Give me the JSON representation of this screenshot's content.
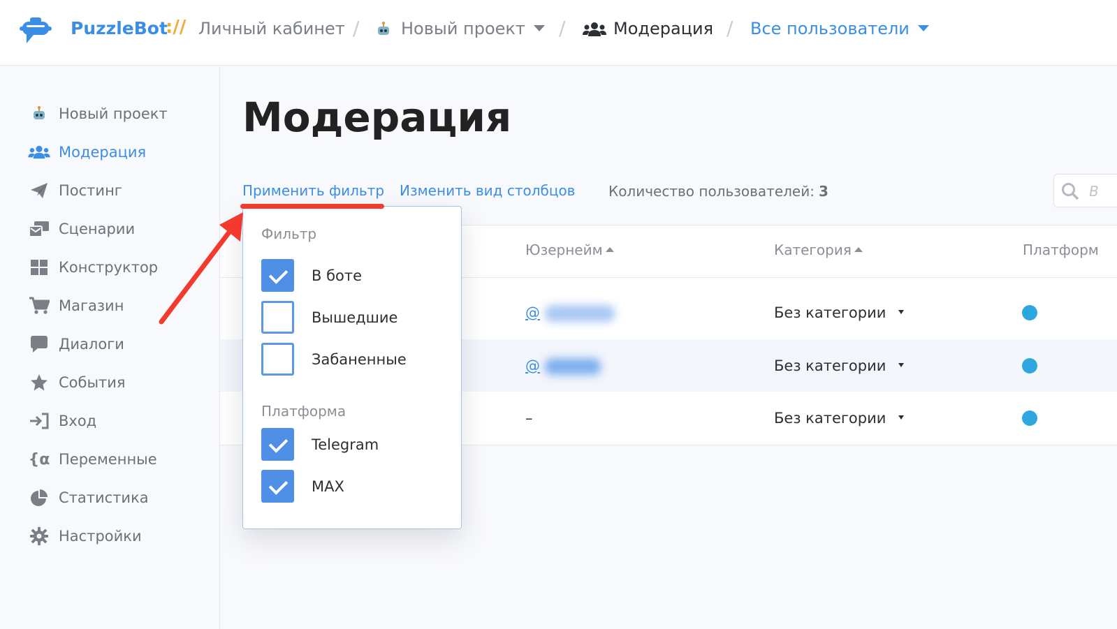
{
  "header": {
    "brand": "PuzzleBot",
    "brand_separator": "://",
    "crumbs": [
      {
        "label": "Личный кабинет"
      },
      {
        "label": "Новый проект"
      },
      {
        "label": "Модерация"
      },
      {
        "label": "Все пользователи"
      }
    ]
  },
  "sidebar": {
    "items": [
      {
        "label": "Новый проект",
        "icon": "robot-icon"
      },
      {
        "label": "Модерация",
        "icon": "users-icon",
        "active": true
      },
      {
        "label": "Постинг",
        "icon": "paper-plane-icon"
      },
      {
        "label": "Сценарии",
        "icon": "mail-bulk-icon"
      },
      {
        "label": "Конструктор",
        "icon": "grid-icon"
      },
      {
        "label": "Магазин",
        "icon": "cart-icon"
      },
      {
        "label": "Диалоги",
        "icon": "chat-icon"
      },
      {
        "label": "События",
        "icon": "star-icon"
      },
      {
        "label": "Вход",
        "icon": "sign-in-icon"
      },
      {
        "label": "Переменные",
        "icon": "variable-icon"
      },
      {
        "label": "Статистика",
        "icon": "pie-chart-icon"
      },
      {
        "label": "Настройки",
        "icon": "gear-icon"
      }
    ]
  },
  "main": {
    "title": "Модерация",
    "apply_filter": "Применить фильтр",
    "change_columns": "Изменить вид столбцов",
    "users_count_label": "Количество пользователей:",
    "users_count": "3",
    "search_placeholder": "В"
  },
  "table": {
    "columns": [
      "Юзернейм",
      "Категория",
      "Платформ"
    ],
    "rows": [
      {
        "username": "@",
        "category": "Без категории",
        "platform": "telegram-icon"
      },
      {
        "username": "@",
        "category": "Без категории",
        "platform": "telegram-icon"
      },
      {
        "username": "–",
        "category": "Без категории",
        "platform": "telegram-icon"
      }
    ]
  },
  "filter": {
    "section_title": "Фильтр",
    "status_options": [
      {
        "label": "В боте",
        "checked": true
      },
      {
        "label": "Вышедшие",
        "checked": false
      },
      {
        "label": "Забаненные",
        "checked": false
      }
    ],
    "platform_title": "Платформа",
    "platform_options": [
      {
        "label": "Telegram",
        "checked": true
      },
      {
        "label": "MAX",
        "checked": true
      }
    ]
  },
  "colors": {
    "accent": "#3b8ee6",
    "checkbox": "#4f8fe6",
    "annotation": "#f23a2e",
    "brand_separator": "#f2a93b"
  }
}
